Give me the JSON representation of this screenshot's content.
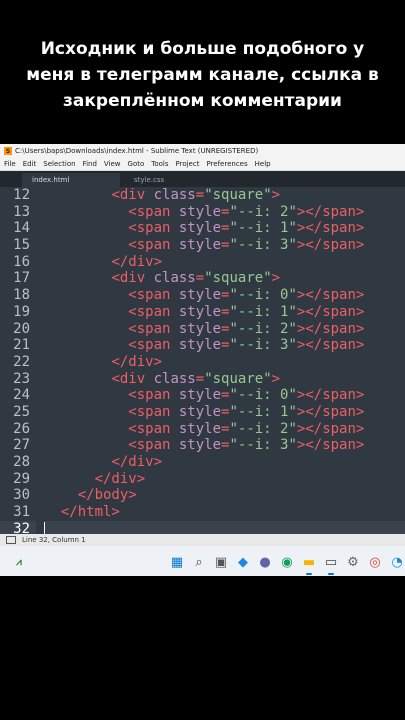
{
  "caption": {
    "line1": "Исходник и больше подобного у",
    "line2": "меня в телеграмм канале, ссылка в",
    "line3": "закреплённом комментарии"
  },
  "window": {
    "title": "C:\\Users\\baps\\Downloads\\index.html - Sublime Text (UNREGISTERED)",
    "app_icon": "S"
  },
  "menu": [
    "File",
    "Edit",
    "Selection",
    "Find",
    "View",
    "Goto",
    "Tools",
    "Project",
    "Preferences",
    "Help"
  ],
  "tabs": [
    {
      "label": "index.html",
      "active": true
    },
    {
      "label": "style.css",
      "active": false
    }
  ],
  "editor": {
    "current_line": 32,
    "lines": [
      {
        "n": "12",
        "tokens": [
          [
            "",
            "        "
          ],
          [
            "t",
            "<div "
          ],
          [
            "a",
            "class"
          ],
          [
            "t",
            "="
          ],
          [
            "s",
            "\"square\""
          ],
          [
            "t",
            ">"
          ]
        ]
      },
      {
        "n": "13",
        "tokens": [
          [
            "",
            "          "
          ],
          [
            "t",
            "<span "
          ],
          [
            "a",
            "style"
          ],
          [
            "t",
            "="
          ],
          [
            "s",
            "\"--i: 2\""
          ],
          [
            "t",
            "></span>"
          ]
        ]
      },
      {
        "n": "14",
        "tokens": [
          [
            "",
            "          "
          ],
          [
            "t",
            "<span "
          ],
          [
            "a",
            "style"
          ],
          [
            "t",
            "="
          ],
          [
            "s",
            "\"--i: 1\""
          ],
          [
            "t",
            "></span>"
          ]
        ]
      },
      {
        "n": "15",
        "tokens": [
          [
            "",
            "          "
          ],
          [
            "t",
            "<span "
          ],
          [
            "a",
            "style"
          ],
          [
            "t",
            "="
          ],
          [
            "s",
            "\"--i: 3\""
          ],
          [
            "t",
            "></span>"
          ]
        ]
      },
      {
        "n": "16",
        "tokens": [
          [
            "",
            "        "
          ],
          [
            "t",
            "</div>"
          ]
        ]
      },
      {
        "n": "17",
        "tokens": [
          [
            "",
            "        "
          ],
          [
            "t",
            "<div "
          ],
          [
            "a",
            "class"
          ],
          [
            "t",
            "="
          ],
          [
            "s",
            "\"square\""
          ],
          [
            "t",
            ">"
          ]
        ]
      },
      {
        "n": "18",
        "tokens": [
          [
            "",
            "          "
          ],
          [
            "t",
            "<span "
          ],
          [
            "a",
            "style"
          ],
          [
            "t",
            "="
          ],
          [
            "s",
            "\"--i: 0\""
          ],
          [
            "t",
            "></span>"
          ]
        ]
      },
      {
        "n": "19",
        "tokens": [
          [
            "",
            "          "
          ],
          [
            "t",
            "<span "
          ],
          [
            "a",
            "style"
          ],
          [
            "t",
            "="
          ],
          [
            "s",
            "\"--i: 1\""
          ],
          [
            "t",
            "></span>"
          ]
        ]
      },
      {
        "n": "20",
        "tokens": [
          [
            "",
            "          "
          ],
          [
            "t",
            "<span "
          ],
          [
            "a",
            "style"
          ],
          [
            "t",
            "="
          ],
          [
            "s",
            "\"--i: 2\""
          ],
          [
            "t",
            "></span>"
          ]
        ]
      },
      {
        "n": "21",
        "tokens": [
          [
            "",
            "          "
          ],
          [
            "t",
            "<span "
          ],
          [
            "a",
            "style"
          ],
          [
            "t",
            "="
          ],
          [
            "s",
            "\"--i: 3\""
          ],
          [
            "t",
            "></span>"
          ]
        ]
      },
      {
        "n": "22",
        "tokens": [
          [
            "",
            "        "
          ],
          [
            "t",
            "</div>"
          ]
        ]
      },
      {
        "n": "23",
        "tokens": [
          [
            "",
            "        "
          ],
          [
            "t",
            "<div "
          ],
          [
            "a",
            "class"
          ],
          [
            "t",
            "="
          ],
          [
            "s",
            "\"square\""
          ],
          [
            "t",
            ">"
          ]
        ]
      },
      {
        "n": "24",
        "tokens": [
          [
            "",
            "          "
          ],
          [
            "t",
            "<span "
          ],
          [
            "a",
            "style"
          ],
          [
            "t",
            "="
          ],
          [
            "s",
            "\"--i: 0\""
          ],
          [
            "t",
            "></span>"
          ]
        ]
      },
      {
        "n": "25",
        "tokens": [
          [
            "",
            "          "
          ],
          [
            "t",
            "<span "
          ],
          [
            "a",
            "style"
          ],
          [
            "t",
            "="
          ],
          [
            "s",
            "\"--i: 1\""
          ],
          [
            "t",
            "></span>"
          ]
        ]
      },
      {
        "n": "26",
        "tokens": [
          [
            "",
            "          "
          ],
          [
            "t",
            "<span "
          ],
          [
            "a",
            "style"
          ],
          [
            "t",
            "="
          ],
          [
            "s",
            "\"--i: 2\""
          ],
          [
            "t",
            "></span>"
          ]
        ]
      },
      {
        "n": "27",
        "tokens": [
          [
            "",
            "          "
          ],
          [
            "t",
            "<span "
          ],
          [
            "a",
            "style"
          ],
          [
            "t",
            "="
          ],
          [
            "s",
            "\"--i: 3\""
          ],
          [
            "t",
            "></span>"
          ]
        ]
      },
      {
        "n": "28",
        "tokens": [
          [
            "",
            "        "
          ],
          [
            "t",
            "</div>"
          ]
        ]
      },
      {
        "n": "29",
        "tokens": [
          [
            "",
            "      "
          ],
          [
            "t",
            "</div>"
          ]
        ]
      },
      {
        "n": "30",
        "tokens": [
          [
            "",
            "    "
          ],
          [
            "t",
            "</body>"
          ]
        ]
      },
      {
        "n": "31",
        "tokens": [
          [
            "",
            "  "
          ],
          [
            "t",
            "</html>"
          ]
        ]
      },
      {
        "n": "32",
        "tokens": [
          [
            "",
            ""
          ]
        ]
      }
    ]
  },
  "status": {
    "position": "Line 32, Column 1"
  },
  "taskbar": {
    "icons": [
      {
        "name": "windows-start-icon",
        "glyph": "▦",
        "color": "#0078d4"
      },
      {
        "name": "search-icon",
        "glyph": "⌕",
        "color": "#444444"
      },
      {
        "name": "task-view-icon",
        "glyph": "▣",
        "color": "#555555"
      },
      {
        "name": "widgets-icon",
        "glyph": "◆",
        "color": "#1e88e5"
      },
      {
        "name": "teams-chat-icon",
        "glyph": "●",
        "color": "#6264a7"
      },
      {
        "name": "edge-browser-icon",
        "glyph": "◉",
        "color": "#0f9d58"
      },
      {
        "name": "file-explorer-icon",
        "glyph": "▬",
        "color": "#f4b400"
      },
      {
        "name": "terminal-icon",
        "glyph": "▭",
        "color": "#444444"
      },
      {
        "name": "settings-gear-icon",
        "glyph": "⚙",
        "color": "#666666"
      },
      {
        "name": "chrome-browser-icon",
        "glyph": "◎",
        "color": "#db4437"
      },
      {
        "name": "edge-icon",
        "glyph": "◔",
        "color": "#0b8fd6"
      }
    ]
  }
}
